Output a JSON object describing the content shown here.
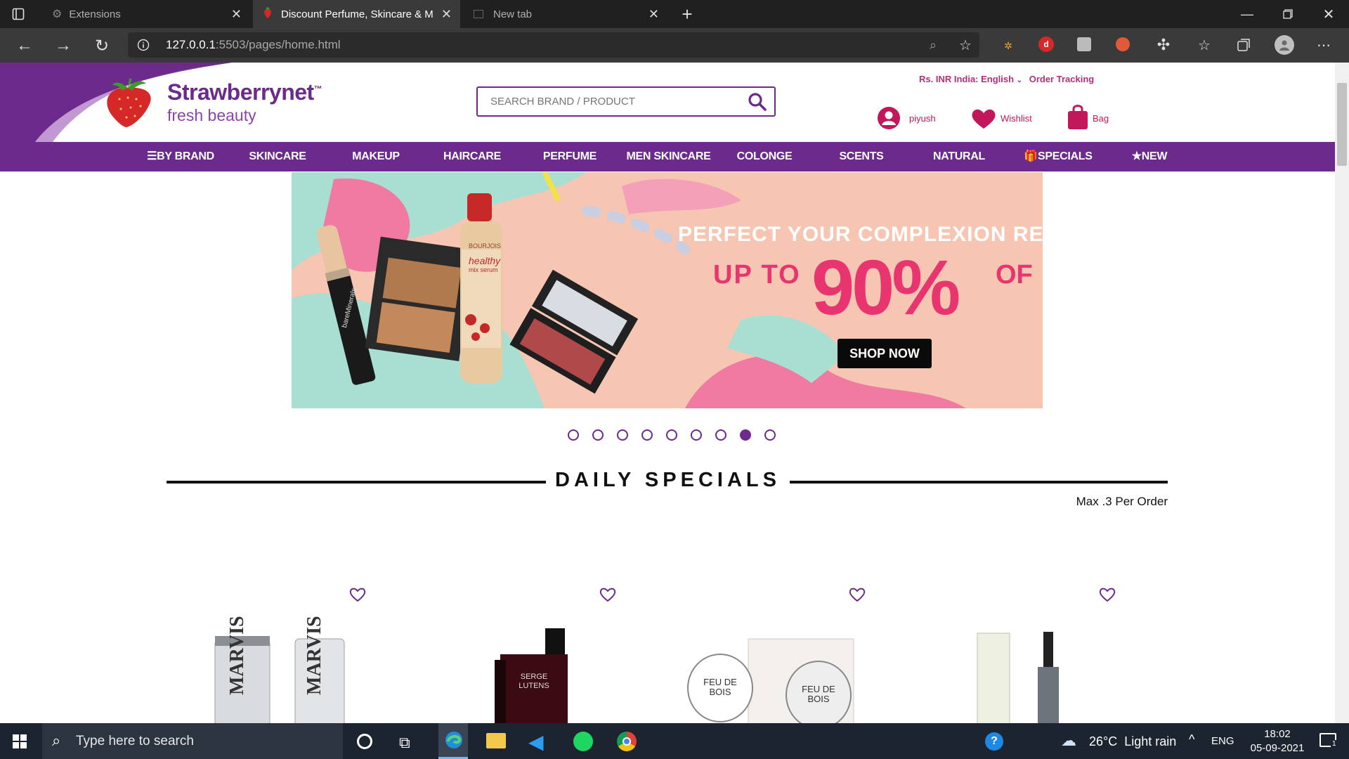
{
  "browser": {
    "tabs": [
      {
        "label": "Extensions",
        "active": false
      },
      {
        "label": "Discount Perfume, Skincare & M",
        "active": true
      },
      {
        "label": "New tab",
        "active": false
      }
    ],
    "url_host": "127.0.0.1",
    "url_rest": ":5503/pages/home.html"
  },
  "site": {
    "logo_title": "Strawberrynet",
    "logo_tm": "™",
    "logo_sub": "fresh beauty",
    "search_placeholder": "SEARCH BRAND / PRODUCT",
    "locale": "Rs. INR India: English",
    "order_tracking": "Order Tracking",
    "user": "piyush",
    "wishlist": "Wishlist",
    "bag": "Bag",
    "accent": "#6b2a8c",
    "pink": "#c2185b"
  },
  "nav": {
    "items": [
      "BY BRAND",
      "SKINCARE",
      "MAKEUP",
      "HAIRCARE",
      "PERFUME",
      "MEN SKINCARE",
      "COLONGE",
      "SCENTS",
      "NATURAL",
      "SPECIALS",
      "NEW"
    ]
  },
  "banner": {
    "headline": "PERFECT YOUR COMPLEXION RE",
    "upto": "UP TO",
    "percent": "90%",
    "off": "OF",
    "button": "SHOP NOW",
    "product_label_1": "bareMinerals",
    "product_label_2": "healthy",
    "product_label_3": "mix serum",
    "product_brand": "BOURJOIS"
  },
  "carousel": {
    "count": 9,
    "active_index": 7
  },
  "daily_specials": {
    "title": "DAILY SPECIALS",
    "max_note": "Max .3 Per Order",
    "product_texts": [
      "MARVIS",
      "MARVIS",
      "SERGE LUTENS",
      "FEU DE BOIS",
      "FEU DE BOIS"
    ]
  },
  "taskbar": {
    "search_placeholder": "Type here to search",
    "weather": "26°C  Light rain",
    "lang": "ENG",
    "time": "18:02",
    "date": "05-09-2021",
    "notifications": "1"
  }
}
